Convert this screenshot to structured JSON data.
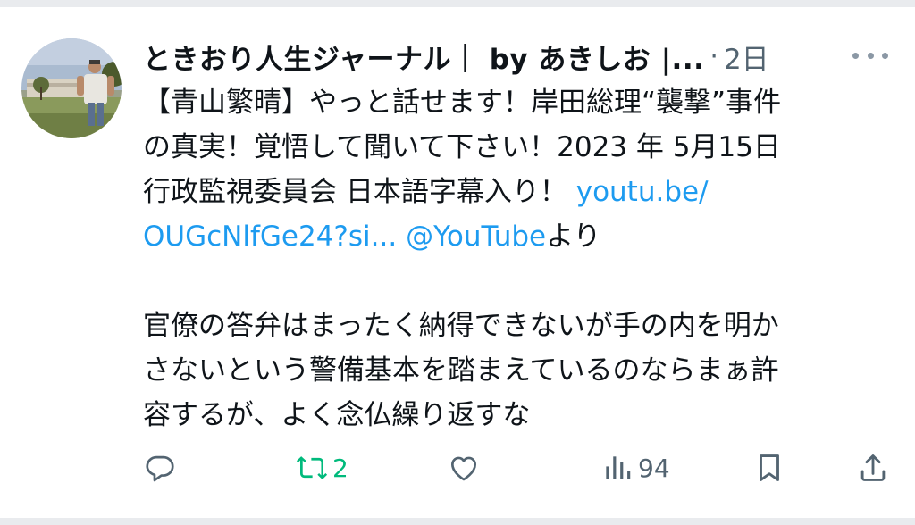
{
  "tweet": {
    "author_name": "ときおり人生ジャーナル｜ by あきしお |...",
    "separator": "·",
    "timestamp": "2日",
    "lines": {
      "l1": "【青山繁晴】やっと話せます！岸田総理“襲撃”事件",
      "l2": "の真実！覚悟して聞いて下さい！2023 年 5月15日",
      "l3_text": "行政監視委員会 日本語字幕入り！ ",
      "l3_link": "youtu.be/",
      "l4_link": "OUGcNlfGe24?si...",
      "l4_space": " ",
      "l4_mention": "@YouTube",
      "l4_text": "より",
      "l5": "官僚の答弁はまったく納得できないが手の内を明か",
      "l6": "さないという警備基本を踏まえているのならまぁ許",
      "l7": "容するが、よく念仏繰り返すな"
    },
    "link_color": "#1d9bf0"
  },
  "actions": {
    "reply": {
      "icon": "reply-icon",
      "count": ""
    },
    "retweet": {
      "icon": "retweet-icon",
      "count": "2",
      "color": "#00ba7c"
    },
    "like": {
      "icon": "heart-icon",
      "count": ""
    },
    "views": {
      "icon": "views-icon",
      "count": "94"
    },
    "bookmark": {
      "icon": "bookmark-icon"
    },
    "share": {
      "icon": "share-icon"
    }
  }
}
